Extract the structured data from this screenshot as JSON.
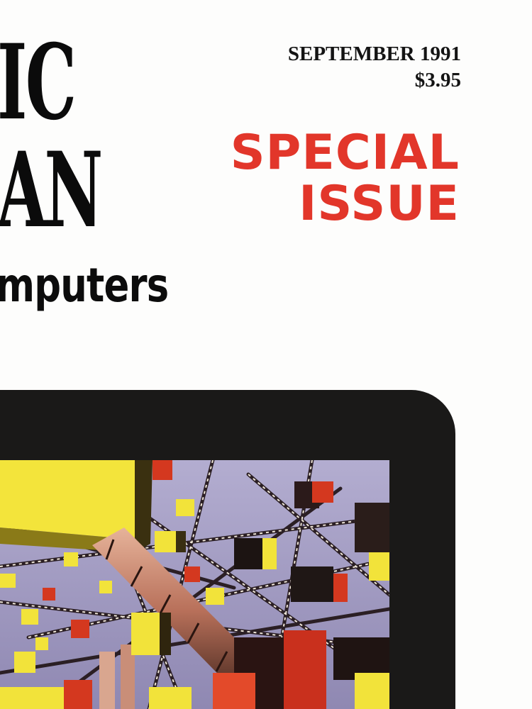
{
  "masthead": {
    "line1": "IC",
    "line2": "AN"
  },
  "issue": {
    "date": "SEPTEMBER 1991",
    "price": "$3.95"
  },
  "special": {
    "line1": "SPECIAL",
    "line2": "ISSUE"
  },
  "topic": "mputers",
  "colors": {
    "accent_red": "#e2362a",
    "text_black": "#0b0b0b",
    "monitor_bezel": "#1a1918",
    "screen_sky": "#a9a3c7",
    "cube_yellow": "#f2e33a",
    "cube_red": "#d4381f"
  }
}
